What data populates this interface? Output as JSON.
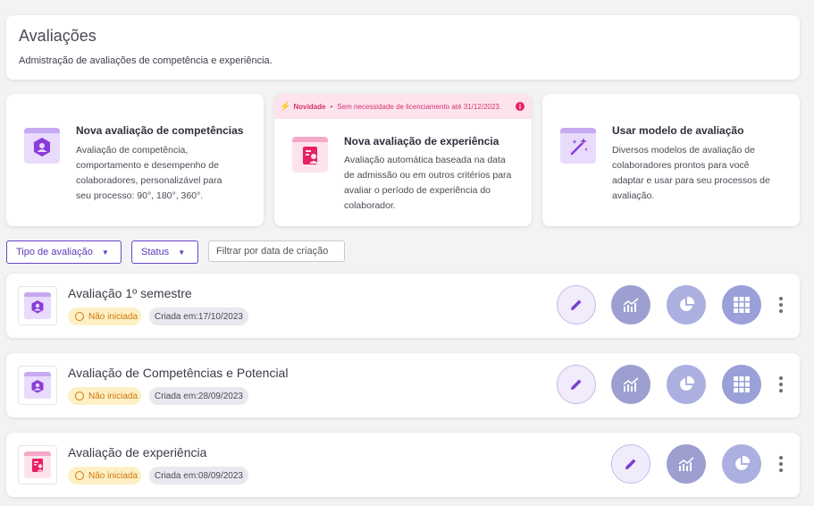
{
  "header": {
    "title": "Avaliações",
    "subtitle": "Admistração de avaliações de competência e experiência."
  },
  "options": [
    {
      "title": "Nova avaliação de competências",
      "description": "Avaliação de competência, comportamento e desempenho de colaboradores, personalizável para seu processo: 90°, 180°, 360°.",
      "icon": "hexagon-person-icon"
    },
    {
      "banner_tag": "Novidade",
      "banner_text": "Sem necessidade de licenciamento até 31/12/2023.",
      "title": "Nova avaliação de experiência",
      "description": "Avaliação automática baseada na data de admissão ou em outros critérios para avaliar o período de experiência do colaborador.",
      "icon": "badge-person-icon"
    },
    {
      "title": "Usar modelo de avaliação",
      "description": "Diversos modelos de avaliação de colaboradores prontos para você adaptar e usar para seu processos de avaliação.",
      "icon": "magic-wand-icon"
    }
  ],
  "filters": {
    "type_label": "Tipo de avaliação",
    "status_label": "Status",
    "date_placeholder": "Filtrar por data de criação"
  },
  "evaluations": [
    {
      "title": "Avaliação 1º semestre",
      "status": "Não iniciada",
      "created": "Criada em:17/10/2023",
      "kind": "competencia"
    },
    {
      "title": "Avaliação de Competências e Potencial",
      "status": "Não iniciada",
      "created": "Criada em:28/09/2023",
      "kind": "competencia"
    },
    {
      "title": "Avaliação de experiência",
      "status": "Não iniciada",
      "created": "Criada em:08/09/2023",
      "kind": "experiencia"
    }
  ],
  "colors": {
    "accent": "#6a44c8",
    "pink": "#e91e63",
    "status_pending": "#d2760a"
  }
}
